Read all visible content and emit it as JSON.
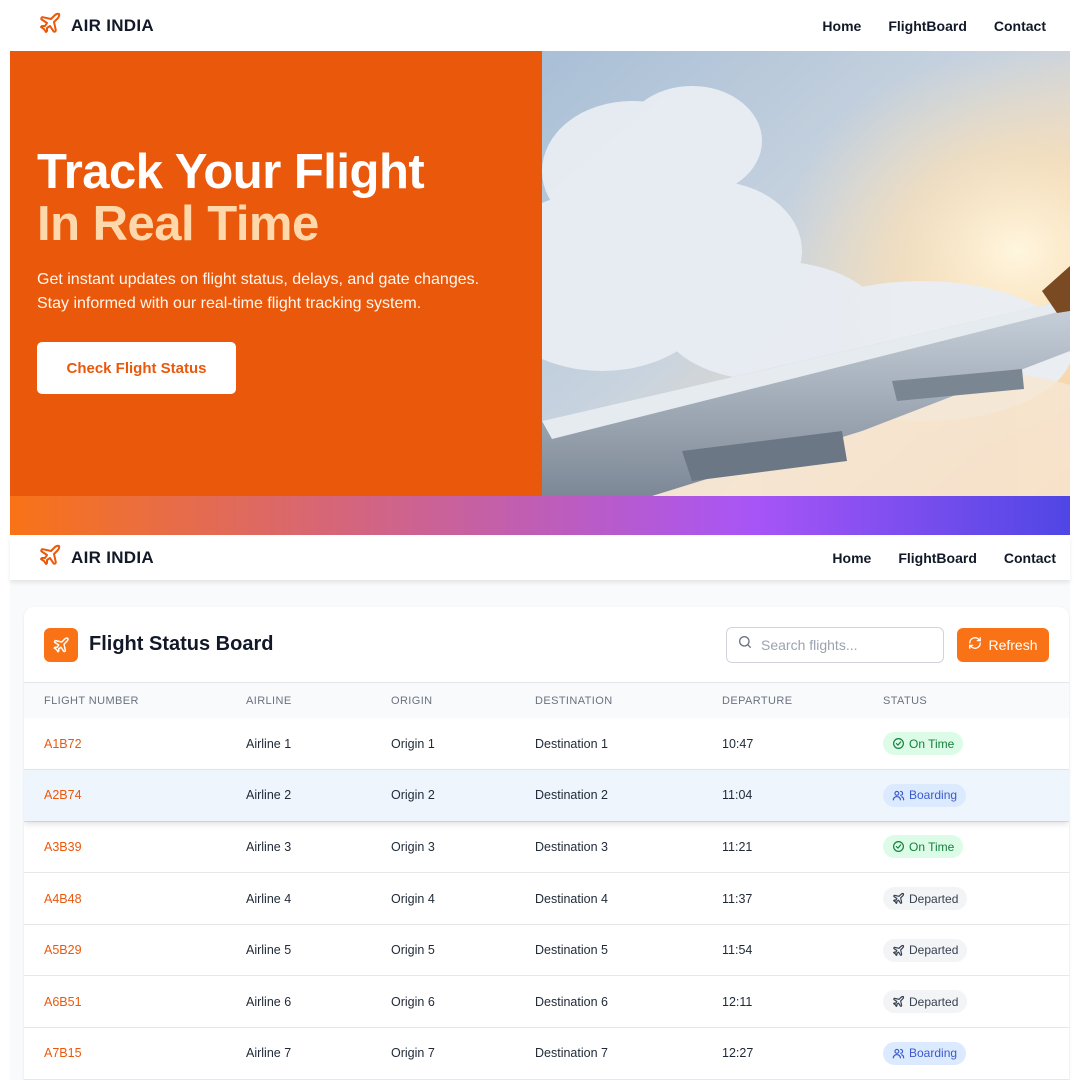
{
  "brand": {
    "name": "AIR INDIA",
    "accent": "#ea580c"
  },
  "nav": {
    "links": [
      "Home",
      "FlightBoard",
      "Contact"
    ]
  },
  "hero": {
    "title_line1": "Track Your Flight",
    "title_line2": "In Real Time",
    "description_line1": "Get instant updates on flight status, delays, and gate changes.",
    "description_line2": "Stay informed with our real-time flight tracking system.",
    "cta_label": "Check Flight Status"
  },
  "board": {
    "title": "Flight Status Board",
    "search_placeholder": "Search flights...",
    "refresh_label": "Refresh",
    "columns": [
      "Flight Number",
      "Airline",
      "Origin",
      "Destination",
      "Departure",
      "Status"
    ],
    "rows": [
      {
        "flight": "A1B72",
        "airline": "Airline 1",
        "origin": "Origin 1",
        "destination": "Destination 1",
        "departure": "10:47",
        "status": "On Time",
        "status_icon": "check-circle-icon"
      },
      {
        "flight": "A2B74",
        "airline": "Airline 2",
        "origin": "Origin 2",
        "destination": "Destination 2",
        "departure": "11:04",
        "status": "Boarding",
        "status_icon": "users-icon"
      },
      {
        "flight": "A3B39",
        "airline": "Airline 3",
        "origin": "Origin 3",
        "destination": "Destination 3",
        "departure": "11:21",
        "status": "On Time",
        "status_icon": "check-circle-icon"
      },
      {
        "flight": "A4B48",
        "airline": "Airline 4",
        "origin": "Origin 4",
        "destination": "Destination 4",
        "departure": "11:37",
        "status": "Departed",
        "status_icon": "plane-icon"
      },
      {
        "flight": "A5B29",
        "airline": "Airline 5",
        "origin": "Origin 5",
        "destination": "Destination 5",
        "departure": "11:54",
        "status": "Departed",
        "status_icon": "plane-icon"
      },
      {
        "flight": "A6B51",
        "airline": "Airline 6",
        "origin": "Origin 6",
        "destination": "Destination 6",
        "departure": "12:11",
        "status": "Departed",
        "status_icon": "plane-icon"
      },
      {
        "flight": "A7B15",
        "airline": "Airline 7",
        "origin": "Origin 7",
        "destination": "Destination 7",
        "departure": "12:27",
        "status": "Boarding",
        "status_icon": "users-icon"
      }
    ]
  },
  "colors": {
    "orange": "#ea580c",
    "on_time": "#15803d",
    "boarding": "#3b5bcc",
    "departed": "#374151"
  }
}
